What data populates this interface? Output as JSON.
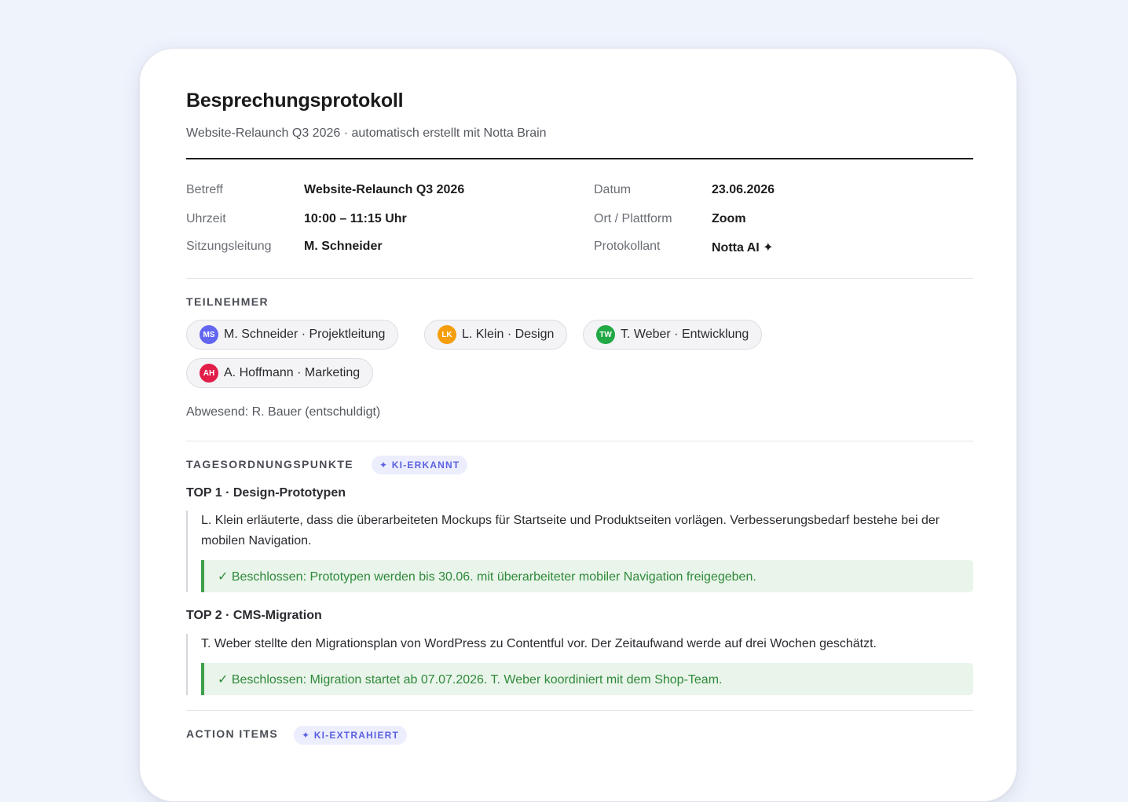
{
  "document": {
    "title": "Besprechungsprotokoll",
    "subtitle": "Website-Relaunch Q3 2026 · automatisch erstellt mit Notta Brain"
  },
  "meta": {
    "betreff_label": "Betreff",
    "betreff_value": "Website-Relaunch Q3 2026",
    "datum_label": "Datum",
    "datum_value": "23.06.2026",
    "uhrzeit_label": "Uhrzeit",
    "uhrzeit_value": "10:00 – 11:15 Uhr",
    "ort_label": "Ort / Plattform",
    "ort_value": "Zoom",
    "leitung_label": "Sitzungsleitung",
    "leitung_value": "M. Schneider",
    "protokollant_label": "Protokollant",
    "protokollant_value": "Notta AI ✦"
  },
  "participants": {
    "heading": "TEILNEHMER",
    "items": [
      {
        "initials": "MS",
        "label": "M. Schneider · Projektleitung",
        "color": "#6366f1"
      },
      {
        "initials": "LK",
        "label": "L. Klein · Design",
        "color": "#f59e0b"
      },
      {
        "initials": "TW",
        "label": "T. Weber · Entwicklung",
        "color": "#22a845"
      },
      {
        "initials": "AH",
        "label": "A. Hoffmann · Marketing",
        "color": "#e11d48"
      }
    ],
    "absent": "Abwesend: R. Bauer (entschuldigt)"
  },
  "agenda": {
    "heading": "TAGESORDNUNGSPUNKTE",
    "badge": "✦ KI-ERKANNT",
    "items": [
      {
        "heading": "TOP 1 · Design-Prototypen",
        "text": "L. Klein erläuterte, dass die überarbeiteten Mockups für Startseite und Produktseiten vorlägen. Verbesserungsbedarf bestehe bei der mobilen Navigation.",
        "decision": "✓ Beschlossen: Prototypen werden bis 30.06. mit überarbeiteter mobiler Navigation freigegeben."
      },
      {
        "heading": "TOP 2 · CMS-Migration",
        "text": "T. Weber stellte den Migrationsplan von WordPress zu Contentful vor. Der Zeitaufwand werde auf drei Wochen geschätzt.",
        "decision": "✓ Beschlossen: Migration startet ab 07.07.2026. T. Weber koordiniert mit dem Shop-Team."
      }
    ]
  },
  "action_items": {
    "heading": "ACTION ITEMS",
    "badge": "✦ KI-EXTRAHIERT"
  },
  "colors": {
    "accent": "#5b61e0",
    "decision_text": "#2f8a3a",
    "decision_bg": "#e9f4ea",
    "background": "#eff3fc"
  }
}
